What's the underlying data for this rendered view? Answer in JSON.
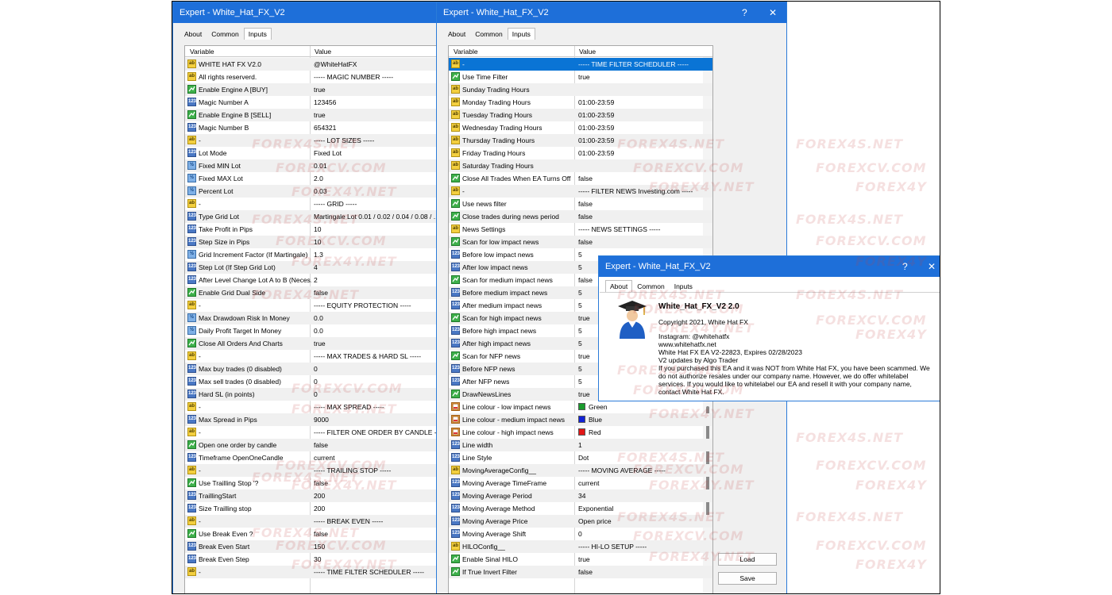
{
  "win1": {
    "title": "Expert - White_Hat_FX_V2",
    "tabs": [
      "About",
      "Common",
      "Inputs"
    ],
    "headers": {
      "variable": "Variable",
      "value": "Value"
    },
    "rows": [
      {
        "icon": "ab",
        "name": "WHITE HAT FX V2.0",
        "value": "@WhiteHatFX"
      },
      {
        "icon": "ab",
        "name": "All rights reserverd.",
        "value": "----- MAGIC NUMBER -----"
      },
      {
        "icon": "bool",
        "name": "Enable Engine A  [BUY]",
        "value": "true"
      },
      {
        "icon": "num",
        "name": "Magic Number  A",
        "value": "123456"
      },
      {
        "icon": "bool",
        "name": "Enable Engine B  [SELL]",
        "value": "true"
      },
      {
        "icon": "num",
        "name": "Magic Number  B",
        "value": "654321"
      },
      {
        "icon": "ab",
        "name": "-",
        "value": "----- LOT SIZES -----"
      },
      {
        "icon": "num",
        "name": "Lot Mode",
        "value": "Fixed Lot"
      },
      {
        "icon": "dbl",
        "name": "Fixed MIN Lot",
        "value": "0.01"
      },
      {
        "icon": "dbl",
        "name": "Fixed MAX Lot",
        "value": "2.0"
      },
      {
        "icon": "dbl",
        "name": "Percent Lot",
        "value": "0.03"
      },
      {
        "icon": "ab",
        "name": "-",
        "value": "----- GRID -----"
      },
      {
        "icon": "num",
        "name": "Type Grid Lot",
        "value": "Martingale Lot  0.01 / 0.02 / 0.04 / 0.08 / ..."
      },
      {
        "icon": "num",
        "name": "Take Profit in Pips",
        "value": "10"
      },
      {
        "icon": "num",
        "name": "Step Size in Pips",
        "value": "10"
      },
      {
        "icon": "dbl",
        "name": "Grid Increment Factor (If Martingale)",
        "value": "1.3"
      },
      {
        "icon": "num",
        "name": "Step Lot (If Step Grid Lot)",
        "value": "4"
      },
      {
        "icon": "num",
        "name": "After Level Change Lot A to B (Neces...",
        "value": "2"
      },
      {
        "icon": "bool",
        "name": "Enable Grid Dual Side",
        "value": "false"
      },
      {
        "icon": "ab",
        "name": "-",
        "value": "----- EQUITY PROTECTION -----"
      },
      {
        "icon": "dbl",
        "name": "Max Drawdown Risk In Money",
        "value": "0.0"
      },
      {
        "icon": "dbl",
        "name": "Daily Profit Target In Money",
        "value": "0.0"
      },
      {
        "icon": "bool",
        "name": "Close All Orders And Charts",
        "value": "true"
      },
      {
        "icon": "ab",
        "name": "-",
        "value": "----- MAX TRADES & HARD SL -----"
      },
      {
        "icon": "num",
        "name": "Max buy trades (0 disabled)",
        "value": "0"
      },
      {
        "icon": "num",
        "name": "Max sell trades (0 disabled)",
        "value": "0"
      },
      {
        "icon": "num",
        "name": "Hard SL (in points)",
        "value": "0"
      },
      {
        "icon": "ab",
        "name": "-",
        "value": "----- MAX SPREAD -----"
      },
      {
        "icon": "num",
        "name": "Max Spread in Pips",
        "value": "9000"
      },
      {
        "icon": "ab",
        "name": "-",
        "value": "----- FILTER ONE ORDER BY CANDLE -----"
      },
      {
        "icon": "bool",
        "name": "Open one order by candle",
        "value": "false"
      },
      {
        "icon": "num",
        "name": "Timeframe OpenOneCandle",
        "value": "current"
      },
      {
        "icon": "ab",
        "name": "-",
        "value": "----- TRAILING STOP -----"
      },
      {
        "icon": "bool",
        "name": "Use Trailling Stop '?",
        "value": "false"
      },
      {
        "icon": "num",
        "name": "TraillingStart",
        "value": "200"
      },
      {
        "icon": "num",
        "name": "Size Trailling stop",
        "value": "200"
      },
      {
        "icon": "ab",
        "name": "-",
        "value": "----- BREAK EVEN -----"
      },
      {
        "icon": "bool",
        "name": "Use Break Even ?",
        "value": "false"
      },
      {
        "icon": "num",
        "name": "Break Even Start",
        "value": "150"
      },
      {
        "icon": "num",
        "name": "Break Even Step",
        "value": "30"
      },
      {
        "icon": "ab",
        "name": "-",
        "value": "----- TIME FILTER SCHEDULER -----"
      }
    ]
  },
  "win2": {
    "title": "Expert - White_Hat_FX_V2",
    "help": "?",
    "close": "✕",
    "tabs": [
      "About",
      "Common",
      "Inputs"
    ],
    "headers": {
      "variable": "Variable",
      "value": "Value"
    },
    "rows": [
      {
        "icon": "ab",
        "name": "-",
        "value": "----- TIME FILTER SCHEDULER -----",
        "selected": true
      },
      {
        "icon": "bool",
        "name": "Use Time Filter",
        "value": "true"
      },
      {
        "icon": "ab",
        "name": "Sunday Trading Hours",
        "value": ""
      },
      {
        "icon": "ab",
        "name": "Monday Trading Hours",
        "value": "01:00-23:59"
      },
      {
        "icon": "ab",
        "name": "Tuesday Trading Hours",
        "value": "01:00-23:59"
      },
      {
        "icon": "ab",
        "name": "Wednesday Trading Hours",
        "value": "01:00-23:59"
      },
      {
        "icon": "ab",
        "name": "Thursday Trading Hours",
        "value": "01:00-23:59"
      },
      {
        "icon": "ab",
        "name": "Friday Trading Hours",
        "value": "01:00-23:59"
      },
      {
        "icon": "ab",
        "name": "Saturday Trading Hours",
        "value": ""
      },
      {
        "icon": "bool",
        "name": "Close All Trades When EA Turns Off",
        "value": "false"
      },
      {
        "icon": "ab",
        "name": "-",
        "value": "----- FILTER NEWS Investing.com -----"
      },
      {
        "icon": "bool",
        "name": "Use news filter",
        "value": "false"
      },
      {
        "icon": "bool",
        "name": "Close trades during news period",
        "value": "false"
      },
      {
        "icon": "ab",
        "name": "News Settings",
        "value": "----- NEWS SETTINGS -----"
      },
      {
        "icon": "bool",
        "name": "Scan for low impact news",
        "value": "false"
      },
      {
        "icon": "num",
        "name": "Before low impact news",
        "value": "5"
      },
      {
        "icon": "num",
        "name": "After low impact news",
        "value": "5"
      },
      {
        "icon": "bool",
        "name": "Scan for medium impact news",
        "value": "false"
      },
      {
        "icon": "num",
        "name": "Before medium impact news",
        "value": "5"
      },
      {
        "icon": "num",
        "name": "After medium impact news",
        "value": "5"
      },
      {
        "icon": "bool",
        "name": "Scan for high impact news",
        "value": "true"
      },
      {
        "icon": "num",
        "name": "Before high impact news",
        "value": "5"
      },
      {
        "icon": "num",
        "name": "After high impact news",
        "value": "5"
      },
      {
        "icon": "bool",
        "name": "Scan for NFP news",
        "value": "true"
      },
      {
        "icon": "num",
        "name": "Before NFP news",
        "value": "5"
      },
      {
        "icon": "num",
        "name": "After NFP news",
        "value": "5"
      },
      {
        "icon": "bool",
        "name": "DrawNewsLines",
        "value": "true"
      },
      {
        "icon": "col",
        "name": "Line colour - low impact news",
        "value": "Green",
        "swatch": "#1a9b2c"
      },
      {
        "icon": "col",
        "name": "Line colour - medium impact news",
        "value": "Blue",
        "swatch": "#1222d6"
      },
      {
        "icon": "col",
        "name": "Line colour - high impact news",
        "value": "Red",
        "swatch": "#e11515"
      },
      {
        "icon": "num",
        "name": "Line width",
        "value": "1"
      },
      {
        "icon": "num",
        "name": "Line Style",
        "value": "Dot"
      },
      {
        "icon": "ab",
        "name": "MovingAverageConfig__",
        "value": "----- MOVING AVERAGE -----"
      },
      {
        "icon": "num",
        "name": "Moving Average TimeFrame",
        "value": "current"
      },
      {
        "icon": "num",
        "name": "Moving Average Period",
        "value": "34"
      },
      {
        "icon": "num",
        "name": "Moving Average Method",
        "value": "Exponential"
      },
      {
        "icon": "num",
        "name": "Moving Average Price",
        "value": "Open price"
      },
      {
        "icon": "num",
        "name": "Moving Average Shift",
        "value": "0"
      },
      {
        "icon": "ab",
        "name": "HILOConfig__",
        "value": "----- HI-LO SETUP -----"
      },
      {
        "icon": "bool",
        "name": "Enable Sinal  HILO",
        "value": "true"
      },
      {
        "icon": "bool",
        "name": "If True Invert Filter",
        "value": "false"
      }
    ],
    "load_label": "Load",
    "save_label": "Save"
  },
  "win3": {
    "title": "Expert - White_Hat_FX_V2",
    "help": "?",
    "close": "✕",
    "tabs": [
      "About",
      "Common",
      "Inputs"
    ],
    "product_name": "White_Hat_FX_V2 2.0",
    "copyright": "Copyright 2021, White Hat FX",
    "lines": [
      "Instagram: @whitehatfx",
      "www.whitehatfx.net",
      "White Hat FX EA V2-22823, Expires 02/28/2023",
      "V2 updates by Algo Trader",
      "If you purchased this EA and it was NOT from White Hat FX, you have been scammed. We do not authorize resales under our company name. However, we do offer whitelabel services. If you would like to whitelabel our EA and resell it with your company name, contact White Hat FX."
    ]
  },
  "watermarks": [
    "FOREX4S.NET",
    "FOREXCV.COM",
    "FOREX4Y.NET",
    "FOREX4Y"
  ],
  "colors": {
    "titlebar": "#1e6fd9",
    "selection": "#0a74d5"
  }
}
